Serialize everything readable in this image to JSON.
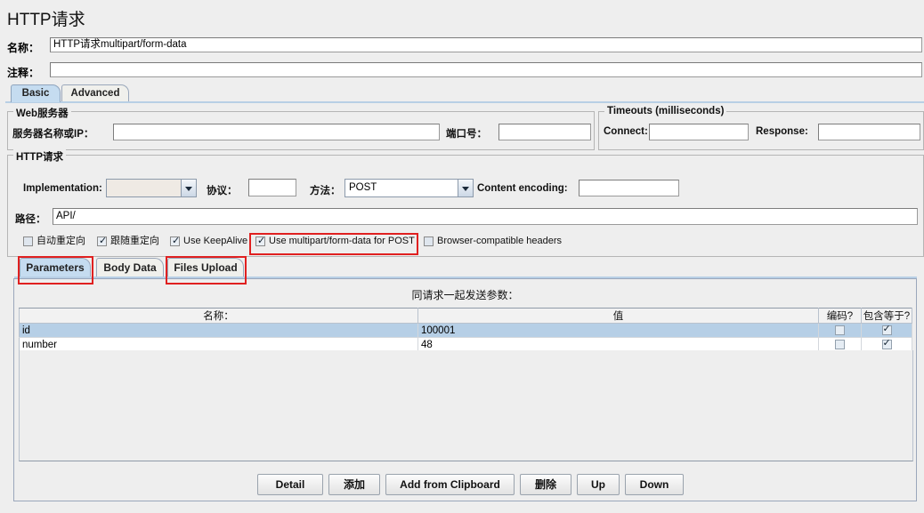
{
  "window": {
    "title": "HTTP请求"
  },
  "header": {
    "name_label": "名称：",
    "name_value": "HTTP请求multipart/form-data",
    "comment_label": "注释：",
    "comment_value": ""
  },
  "main_tabs": [
    {
      "label": "Basic",
      "selected": true
    },
    {
      "label": "Advanced",
      "selected": false
    }
  ],
  "web_server": {
    "group_title": "Web服务器",
    "server_label": "服务器名称或IP：",
    "server_value": "",
    "port_label": "端口号：",
    "port_value": ""
  },
  "timeouts": {
    "group_title": "Timeouts (milliseconds)",
    "connect_label": "Connect:",
    "connect_value": "",
    "response_label": "Response:",
    "response_value": ""
  },
  "http_request": {
    "group_title": "HTTP请求",
    "implementation_label": "Implementation:",
    "implementation_value": "",
    "protocol_label": "协议：",
    "protocol_value": "",
    "method_label": "方法：",
    "method_value": "POST",
    "content_encoding_label": "Content encoding:",
    "content_encoding_value": "",
    "path_label": "路径：",
    "path_value": "API/",
    "checkboxes": [
      {
        "label": "自动重定向",
        "checked": false
      },
      {
        "label": "跟随重定向",
        "checked": true
      },
      {
        "label": "Use KeepAlive",
        "checked": true
      },
      {
        "label": "Use multipart/form-data for POST",
        "checked": true
      },
      {
        "label": "Browser-compatible headers",
        "checked": false
      }
    ]
  },
  "param_tabs": [
    {
      "label": "Parameters",
      "selected": true
    },
    {
      "label": "Body Data",
      "selected": false
    },
    {
      "label": "Files Upload",
      "selected": false
    }
  ],
  "params_table": {
    "caption": "同请求一起发送参数：",
    "columns": [
      "名称：",
      "值",
      "编码?",
      "包含等于?"
    ],
    "rows": [
      {
        "name": "id",
        "value": "100001",
        "encode": false,
        "include_equals": true,
        "selected": true
      },
      {
        "name": "number",
        "value": "48",
        "encode": false,
        "include_equals": true,
        "selected": false
      }
    ]
  },
  "buttons": [
    {
      "label": "Detail"
    },
    {
      "label": "添加"
    },
    {
      "label": "Add from Clipboard"
    },
    {
      "label": "删除"
    },
    {
      "label": "Up"
    },
    {
      "label": "Down"
    }
  ],
  "annotations": {
    "accent_color": "#e02020",
    "highlighted": [
      "Use multipart/form-data for POST",
      "Parameters",
      "Files Upload"
    ]
  }
}
